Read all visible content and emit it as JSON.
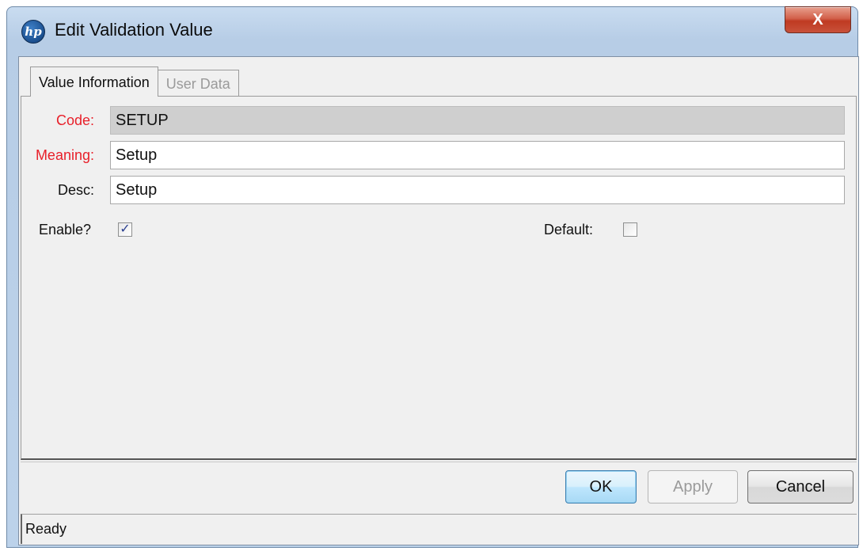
{
  "window": {
    "title": "Edit Validation Value",
    "logo_text": "hp",
    "close_glyph": "X"
  },
  "tabs": [
    {
      "label": "Value Information",
      "state": "active"
    },
    {
      "label": "User Data",
      "state": "disabled"
    }
  ],
  "form": {
    "code": {
      "label": "Code:",
      "value": "SETUP",
      "required": true,
      "readonly": true
    },
    "meaning": {
      "label": "Meaning:",
      "value": "Setup",
      "required": true
    },
    "desc": {
      "label": "Desc:",
      "value": "Setup",
      "required": false
    },
    "enable": {
      "label": "Enable?",
      "checked": true,
      "glyph": "✓"
    },
    "default": {
      "label": "Default:",
      "checked": false
    }
  },
  "buttons": {
    "ok": "OK",
    "apply": "Apply",
    "cancel": "Cancel"
  },
  "status": "Ready",
  "colors": {
    "required_label": "#e8202a",
    "default_button": "#3c7fb1"
  }
}
